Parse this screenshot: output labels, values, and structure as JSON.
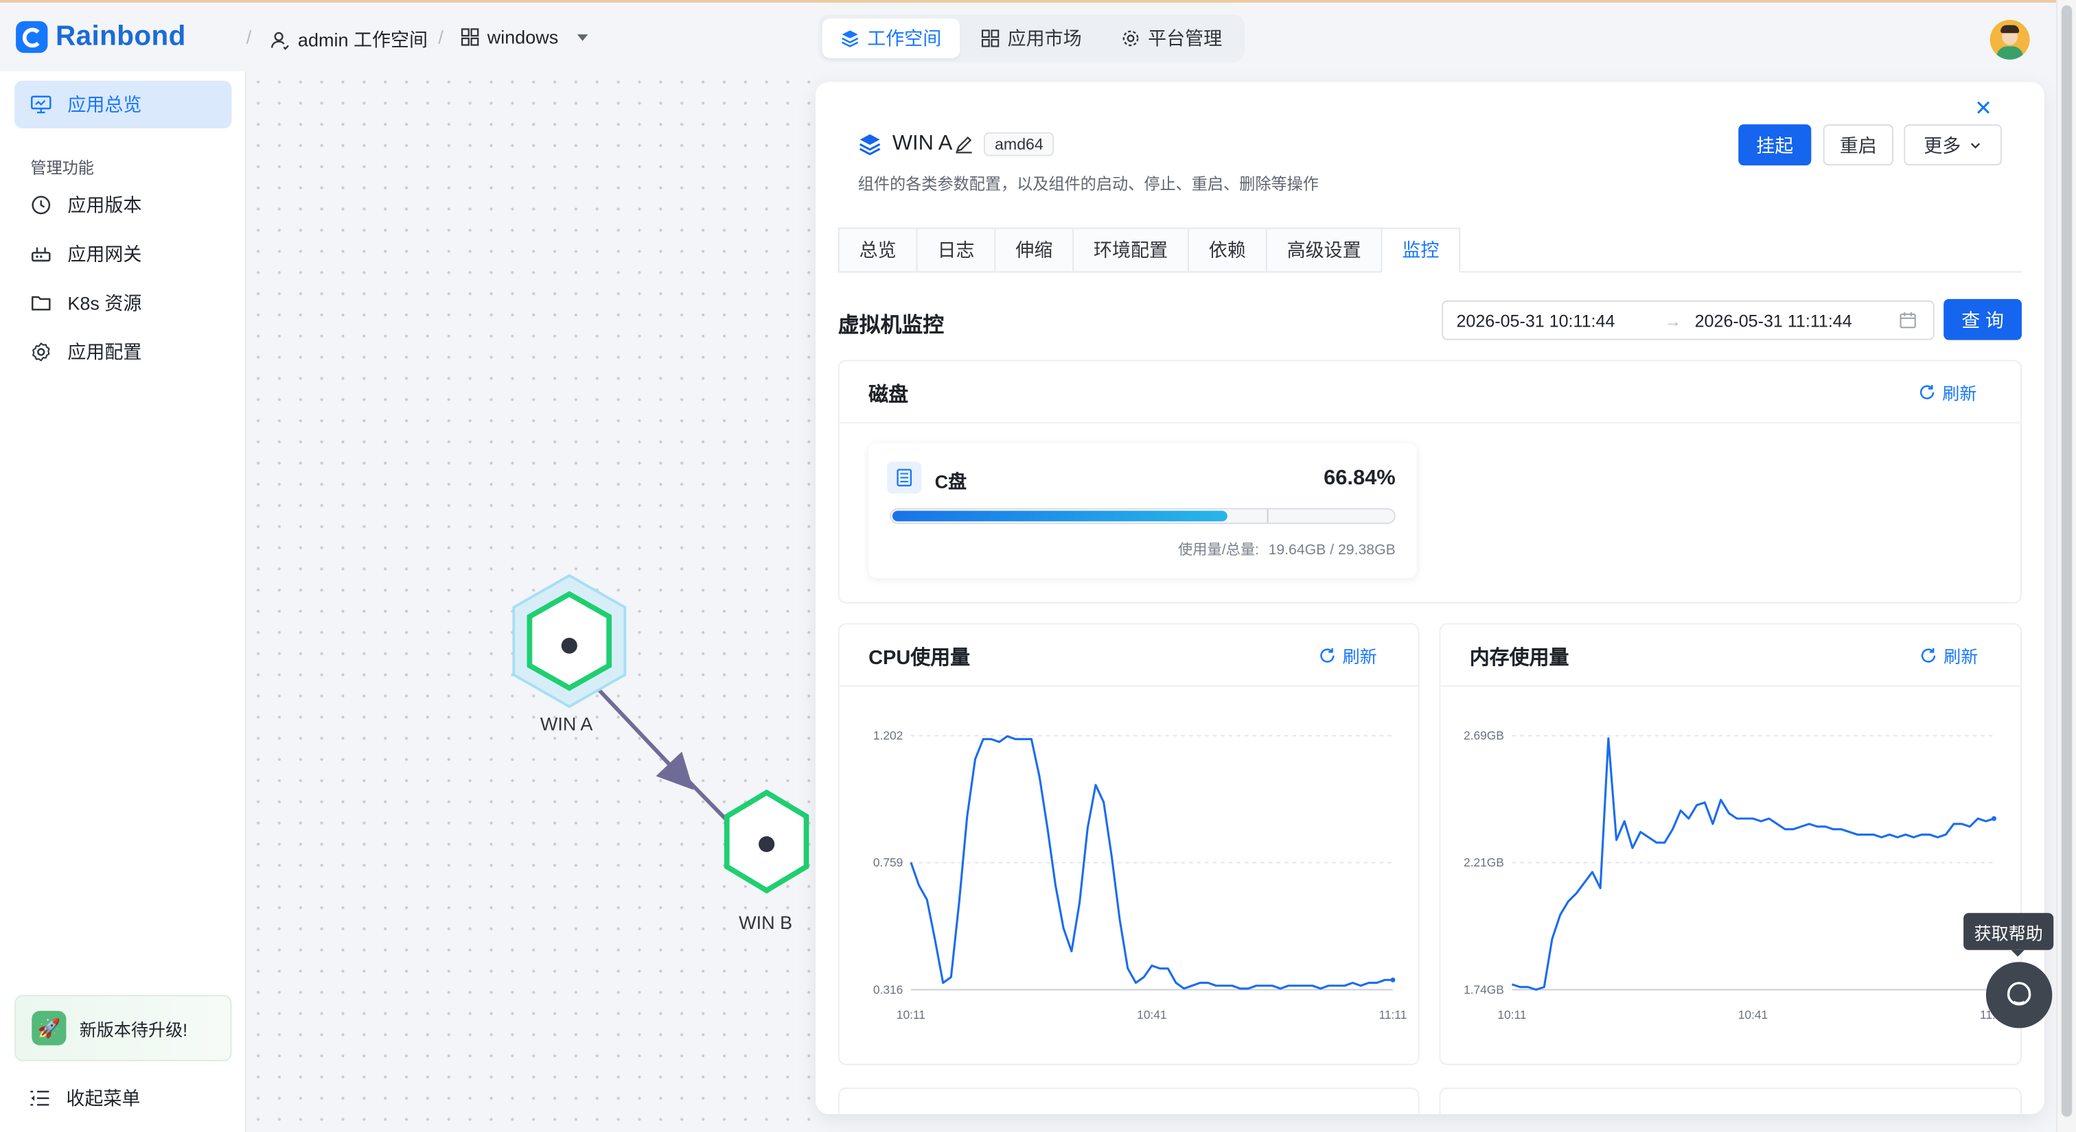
{
  "header": {
    "brand": "Rainbond",
    "workspace": "admin 工作空间",
    "app": "windows",
    "nav": [
      "工作空间",
      "应用市场",
      "平台管理"
    ],
    "active_nav": "工作空间"
  },
  "sidebar": {
    "overview": "应用总览",
    "group_label": "管理功能",
    "items": [
      "应用版本",
      "应用网关",
      "K8s 资源",
      "应用配置"
    ],
    "upgrade": "新版本待升级!",
    "collapse": "收起菜单"
  },
  "topology": {
    "nodes": [
      "WIN A",
      "WIN B"
    ]
  },
  "panel": {
    "component_name": "WIN A",
    "arch": "amd64",
    "description": "组件的各类参数配置，以及组件的启动、停止、重启、删除等操作",
    "buttons": {
      "suspend": "挂起",
      "restart": "重启",
      "more": "更多"
    },
    "tabs": [
      "总览",
      "日志",
      "伸缩",
      "环境配置",
      "依赖",
      "高级设置",
      "监控"
    ],
    "active_tab": "监控",
    "section_title": "虚拟机监控",
    "range_start": "2026-05-31 10:11:44",
    "range_end": "2026-05-31 11:11:44",
    "query": "查 询",
    "refresh": "刷新",
    "disk": {
      "title": "磁盘",
      "name": "C盘",
      "percent_text": "66.84%",
      "percent": 66.84,
      "usage_label": "使用量/总量:",
      "usage_value": "19.64GB / 29.38GB"
    },
    "cpu_title": "CPU使用量",
    "mem_title": "内存使用量"
  },
  "help": {
    "tip": "获取帮助"
  },
  "chart_data": [
    {
      "type": "line",
      "title": "CPU使用量",
      "yticks": [
        "1.202",
        "0.759",
        "0.316"
      ],
      "xticks": [
        "10:11",
        "10:41",
        "11:11"
      ],
      "ylim": [
        0.316,
        1.202
      ],
      "x": [
        0,
        1,
        2,
        3,
        4,
        5,
        6,
        7,
        8,
        9,
        10,
        11,
        12,
        13,
        14,
        15,
        16,
        17,
        18,
        19,
        20,
        21,
        22,
        23,
        24,
        25,
        26,
        27,
        28,
        29,
        30,
        31,
        32,
        33,
        34,
        35,
        36,
        37,
        38,
        39,
        40,
        41,
        42,
        43,
        44,
        45,
        46,
        47,
        48,
        49,
        50,
        51,
        52,
        53,
        54,
        55,
        56,
        57,
        58,
        59,
        60
      ],
      "series": [
        {
          "values": [
            0.76,
            0.68,
            0.63,
            0.49,
            0.34,
            0.36,
            0.62,
            0.92,
            1.12,
            1.19,
            1.19,
            1.18,
            1.2,
            1.19,
            1.19,
            1.19,
            1.06,
            0.88,
            0.68,
            0.53,
            0.45,
            0.62,
            0.88,
            1.03,
            0.97,
            0.78,
            0.56,
            0.39,
            0.34,
            0.36,
            0.4,
            0.39,
            0.39,
            0.34,
            0.32,
            0.33,
            0.34,
            0.34,
            0.33,
            0.33,
            0.33,
            0.32,
            0.32,
            0.33,
            0.33,
            0.33,
            0.32,
            0.33,
            0.33,
            0.33,
            0.33,
            0.32,
            0.33,
            0.33,
            0.33,
            0.34,
            0.33,
            0.34,
            0.34,
            0.35,
            0.35
          ]
        }
      ],
      "grid": true
    },
    {
      "type": "line",
      "title": "内存使用量",
      "yticks": [
        "2.69GB",
        "2.21GB",
        "1.74GB"
      ],
      "xticks": [
        "10:11",
        "10:41",
        "11:11"
      ],
      "ylim": [
        1.74,
        2.69
      ],
      "x": [
        0,
        1,
        2,
        3,
        4,
        5,
        6,
        7,
        8,
        9,
        10,
        11,
        12,
        13,
        14,
        15,
        16,
        17,
        18,
        19,
        20,
        21,
        22,
        23,
        24,
        25,
        26,
        27,
        28,
        29,
        30,
        31,
        32,
        33,
        34,
        35,
        36,
        37,
        38,
        39,
        40,
        41,
        42,
        43,
        44,
        45,
        46,
        47,
        48,
        49,
        50,
        51,
        52,
        53,
        54,
        55,
        56,
        57,
        58,
        59,
        60
      ],
      "series": [
        {
          "values": [
            1.76,
            1.75,
            1.75,
            1.74,
            1.75,
            1.93,
            2.02,
            2.07,
            2.1,
            2.14,
            2.18,
            2.12,
            2.68,
            2.3,
            2.37,
            2.27,
            2.33,
            2.31,
            2.29,
            2.29,
            2.34,
            2.41,
            2.38,
            2.43,
            2.44,
            2.36,
            2.45,
            2.4,
            2.38,
            2.38,
            2.38,
            2.37,
            2.38,
            2.36,
            2.34,
            2.34,
            2.35,
            2.36,
            2.35,
            2.35,
            2.34,
            2.34,
            2.33,
            2.32,
            2.32,
            2.32,
            2.31,
            2.32,
            2.31,
            2.32,
            2.31,
            2.32,
            2.32,
            2.31,
            2.32,
            2.36,
            2.36,
            2.35,
            2.38,
            2.37,
            2.38
          ]
        }
      ],
      "grid": true
    }
  ]
}
